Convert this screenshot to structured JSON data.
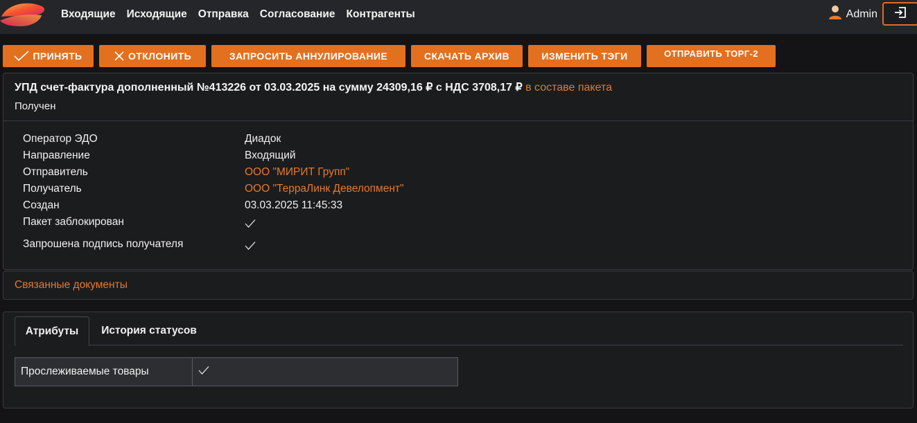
{
  "nav": {
    "items": [
      "Входящие",
      "Исходящие",
      "Отправка",
      "Согласование",
      "Контрагенты"
    ],
    "user": "Admin"
  },
  "toolbar": {
    "accept": "ПРИНЯТЬ",
    "reject": "ОТКЛОНИТЬ",
    "request_annul": "ЗАПРОСИТЬ АННУЛИРОВАНИЕ",
    "download": "СКАЧАТЬ АРХИВ",
    "edit_tags": "ИЗМЕНИТЬ ТЭГИ",
    "send_torg2": "ОТПРАВИТЬ ТОРГ-2"
  },
  "document": {
    "title": "УПД счет-фактура дополненный №413226 от 03.03.2025 на сумму 24309,16 ₽ с НДС 3708,17 ₽",
    "package_link": "в составе пакета",
    "status": "Получен",
    "props": [
      {
        "label": "Оператор ЭДО",
        "value": "Диадок"
      },
      {
        "label": "Направление",
        "value": "Входящий"
      },
      {
        "label": "Отправитель",
        "value": "ООО \"МИРИТ Групп\""
      },
      {
        "label": "Получатель",
        "value": "ООО \"ТерраЛинк Девелопмент\""
      },
      {
        "label": "Создан",
        "value": "03.03.2025 11:45:33"
      },
      {
        "label": "Пакет заблокирован",
        "value": true
      },
      {
        "label": "Запрошена подпись получателя",
        "value": true
      }
    ]
  },
  "related": {
    "label": "Связанные документы"
  },
  "tabs": {
    "items": [
      "Атрибуты",
      "История статусов"
    ],
    "active": "Атрибуты"
  },
  "attributes": [
    {
      "label": "Прослеживаемые товары",
      "value": true
    }
  ],
  "colors": {
    "accent": "#e2701f",
    "link": "#e47a2e",
    "navbar": "#242629",
    "background": "#141416"
  }
}
